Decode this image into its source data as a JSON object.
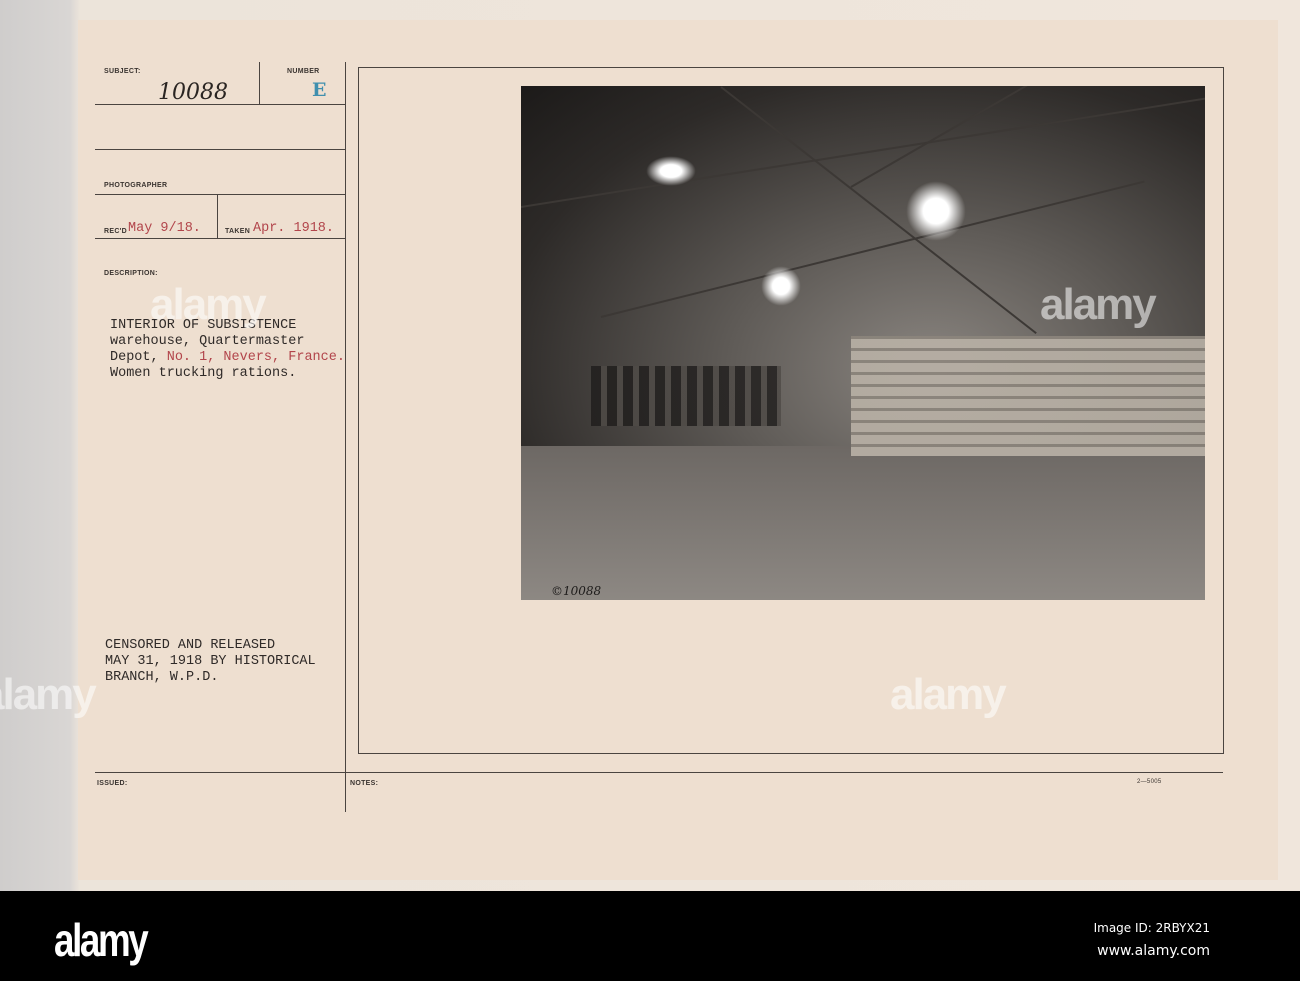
{
  "card": {
    "subject_label": "SUBJECT:",
    "subject_value": "10088",
    "number_label": "NUMBER",
    "number_value": "E",
    "photographer_label": "PHOTOGRAPHER",
    "recd_label": "REC'D",
    "recd_value": "May 9/18.",
    "taken_label": "TAKEN",
    "taken_value": "Apr. 1918.",
    "description_label": "DESCRIPTION:",
    "description_line1": "INTERIOR OF SUBSISTENCE",
    "description_line2": "warehouse, Quartermaster",
    "description_line3_a": "Depot, ",
    "description_line3_b": "No. 1, Nevers, France.",
    "description_line4": "Women trucking rations.",
    "censor_line1": "CENSORED AND RELEASED",
    "censor_line2": "MAY 31, 1918 BY HISTORICAL",
    "censor_line3": "BRANCH, W.P.D.",
    "issued_label": "ISSUED:",
    "notes_label": "NOTES:",
    "form_number": "2—5005",
    "photo_number": "©10088"
  },
  "watermark": "alamy",
  "footer": {
    "logo": "alamy",
    "image_id": "Image ID: 2RBYX21",
    "url": "www.alamy.com"
  },
  "colors": {
    "red_type": "#b2454b",
    "stamp_blue": "#3f8fae"
  }
}
